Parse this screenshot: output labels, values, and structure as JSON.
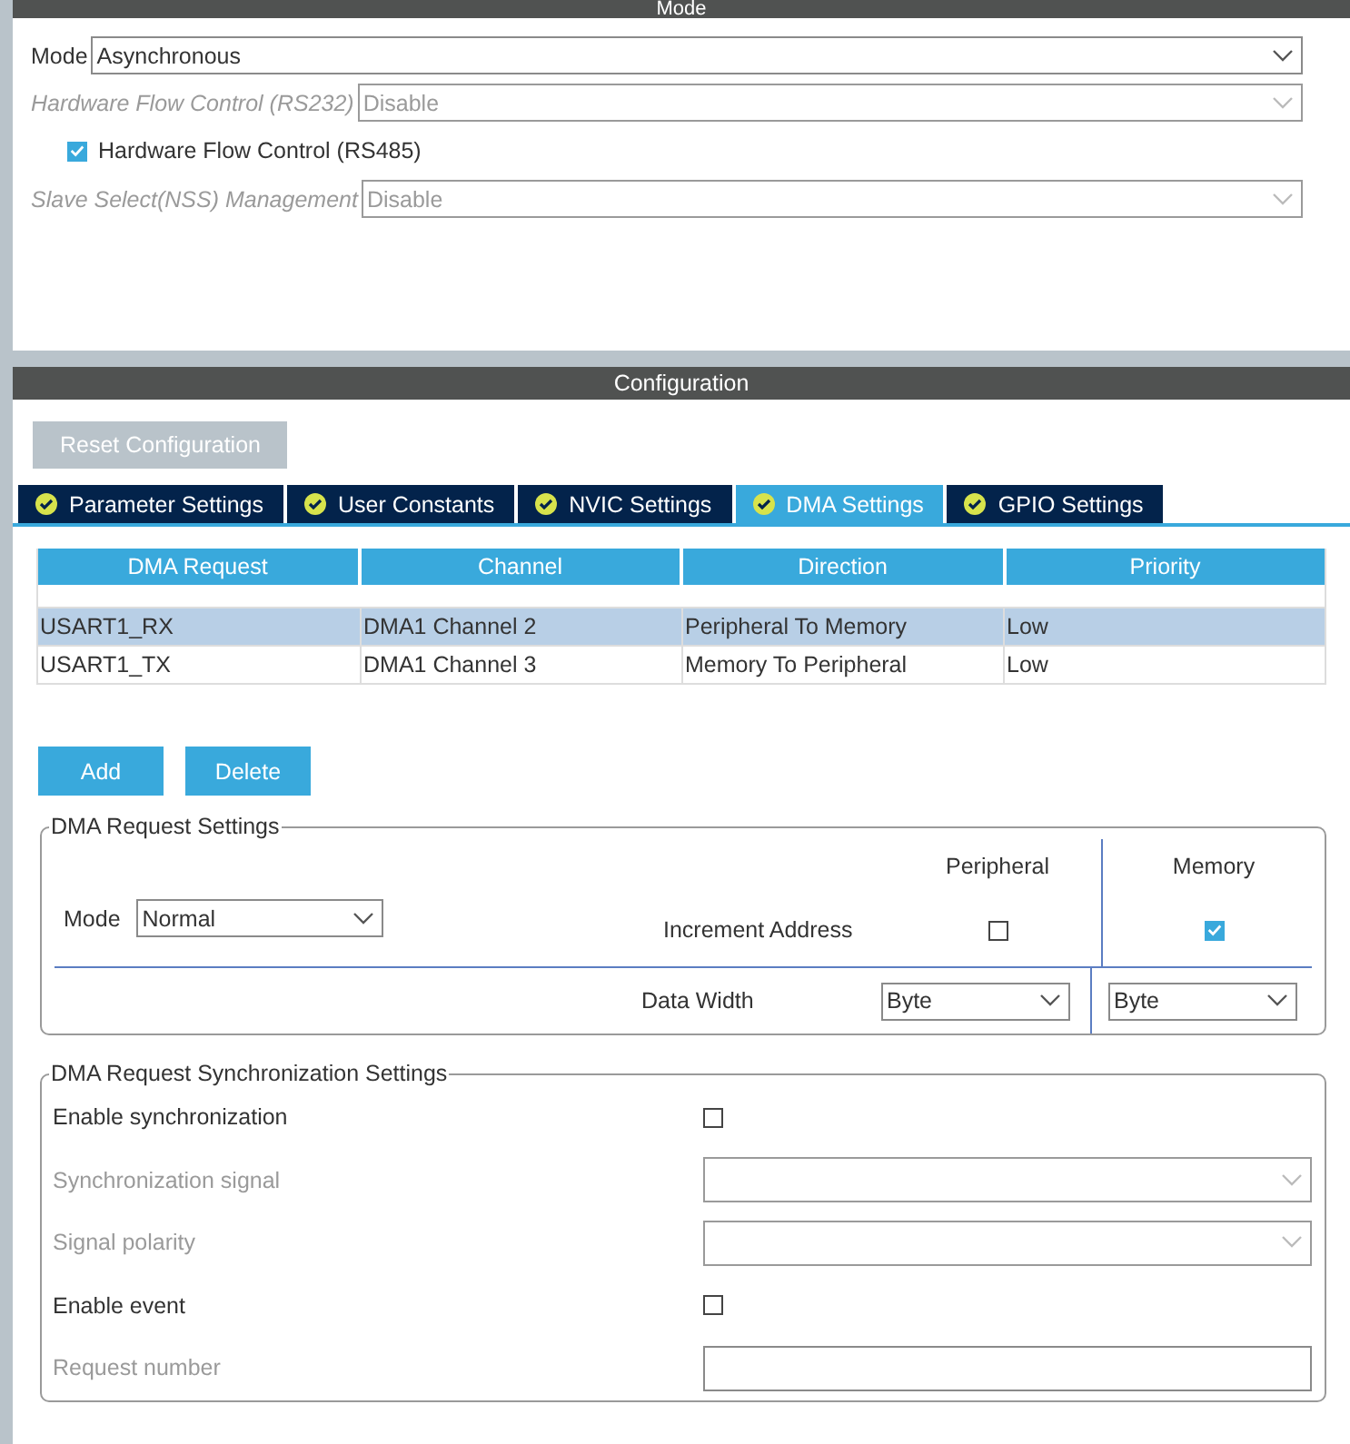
{
  "mode_panel": {
    "title": "Mode",
    "fields": [
      {
        "kind": "select",
        "label": "Mode",
        "value": "Asynchronous",
        "disabled": false
      },
      {
        "kind": "select",
        "label": "Hardware Flow Control (RS232)",
        "value": "Disable",
        "disabled": true
      },
      {
        "kind": "checkbox",
        "label": "Hardware Flow Control (RS485)",
        "checked": true,
        "disabled": false
      },
      {
        "kind": "select",
        "label": "Slave Select(NSS) Management",
        "value": "Disable",
        "disabled": true
      }
    ]
  },
  "configuration": {
    "title": "Configuration",
    "reset_button": {
      "label": "Reset Configuration",
      "disabled": true
    },
    "tabs": [
      {
        "label": "Parameter Settings",
        "selected": false
      },
      {
        "label": "User Constants",
        "selected": false
      },
      {
        "label": "NVIC Settings",
        "selected": false
      },
      {
        "label": "DMA Settings",
        "selected": true
      },
      {
        "label": "GPIO Settings",
        "selected": false
      }
    ],
    "table": {
      "columns": [
        "DMA Request",
        "Channel",
        "Direction",
        "Priority"
      ],
      "rows": [
        {
          "cells": [
            "USART1_RX",
            "DMA1 Channel 2",
            "Peripheral To Memory",
            "Low"
          ],
          "selected": true
        },
        {
          "cells": [
            "USART1_TX",
            "DMA1 Channel 3",
            "Memory To Peripheral",
            "Low"
          ],
          "selected": false
        }
      ]
    },
    "buttons": [
      "Add",
      "Delete"
    ],
    "request_settings": {
      "title": "DMA Request Settings",
      "mode_label": "Mode",
      "mode_value": "Normal",
      "peripheral_heading": "Peripheral",
      "memory_heading": "Memory",
      "increment_label": "Increment Address",
      "peripheral_increment": false,
      "memory_increment": true,
      "data_width_label": "Data Width",
      "peripheral_width": "Byte",
      "memory_width": "Byte"
    },
    "sync_settings": {
      "title": "DMA Request Synchronization Settings",
      "rows": [
        {
          "kind": "checkbox",
          "label": "Enable synchronization",
          "checked": false,
          "disabled": false
        },
        {
          "kind": "select",
          "label": "Synchronization signal",
          "disabled": true
        },
        {
          "kind": "select",
          "label": "Signal polarity",
          "disabled": true
        },
        {
          "kind": "checkbox",
          "label": "Enable event",
          "checked": false,
          "disabled": false
        },
        {
          "kind": "input",
          "label": "Request number",
          "disabled": true
        }
      ]
    }
  }
}
